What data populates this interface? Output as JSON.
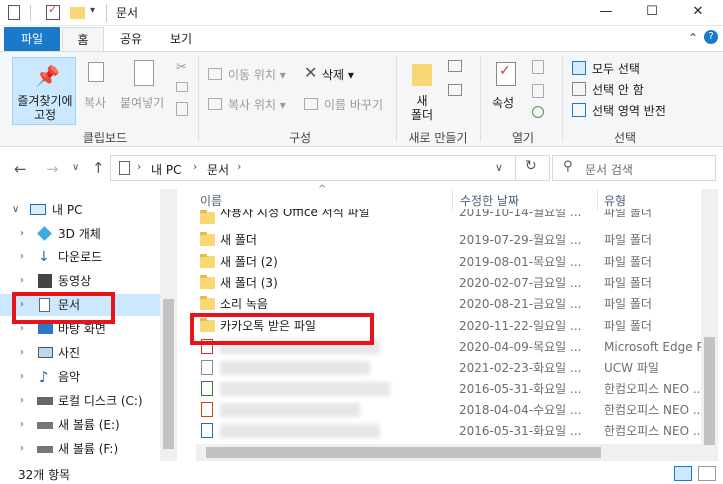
{
  "window": {
    "title": "문서",
    "controls": [
      "—",
      "☐",
      "✕"
    ]
  },
  "ribbon_tabs": [
    "파일",
    "홈",
    "공유",
    "보기"
  ],
  "ribbon": {
    "clipboard": {
      "pin_label": "즐겨찾기에\n고정",
      "copy": "복사",
      "paste": "붙여넣기",
      "group": "클립보드"
    },
    "organize": {
      "move_to": "이동 위치 ▾",
      "copy_to": "복사 위치 ▾",
      "delete": "삭제 ▾",
      "rename": "이름 바꾸기",
      "group": "구성"
    },
    "new": {
      "new_folder": "새\n폴더",
      "group": "새로 만들기"
    },
    "open": {
      "properties": "속성",
      "group": "열기"
    },
    "select": {
      "select_all": "모두 선택",
      "select_none": "선택 안 함",
      "invert": "선택 영역 반전",
      "group": "선택"
    }
  },
  "address": {
    "path": [
      "내 PC",
      "문서"
    ],
    "search_placeholder": "문서 검색"
  },
  "nav": [
    {
      "label": "내 PC",
      "icon": "pc-icon"
    },
    {
      "label": "3D 개체",
      "icon": "cube-icon"
    },
    {
      "label": "다운로드",
      "icon": "download-icon"
    },
    {
      "label": "동영상",
      "icon": "video-icon"
    },
    {
      "label": "문서",
      "icon": "document-icon"
    },
    {
      "label": "바탕 화면",
      "icon": "desktop-icon"
    },
    {
      "label": "사진",
      "icon": "picture-icon"
    },
    {
      "label": "음악",
      "icon": "music-icon"
    },
    {
      "label": "로컬 디스크 (C:)",
      "icon": "disk-icon"
    },
    {
      "label": "새 볼륨 (E:)",
      "icon": "disk-icon"
    },
    {
      "label": "새 볼륨 (F:)",
      "icon": "disk-icon"
    }
  ],
  "columns": {
    "name": "이름",
    "date": "수정한 날짜",
    "type": "유형"
  },
  "files": [
    {
      "name": "사용자 지정 Office 서식 파일",
      "date": "2019-10-14-월요일 ...",
      "type": "파일 폴더",
      "kind": "folder"
    },
    {
      "name": "새 폴더",
      "date": "2019-07-29-월요일 ...",
      "type": "파일 폴더",
      "kind": "folder"
    },
    {
      "name": "새 폴더 (2)",
      "date": "2019-08-01-목요일 ...",
      "type": "파일 폴더",
      "kind": "folder"
    },
    {
      "name": "새 폴더 (3)",
      "date": "2020-02-07-금요일 ...",
      "type": "파일 폴더",
      "kind": "folder"
    },
    {
      "name": "소리 녹음",
      "date": "2020-08-21-금요일 ...",
      "type": "파일 폴더",
      "kind": "folder"
    },
    {
      "name": "카카오톡 받은 파일",
      "date": "2020-11-22-일요일 ...",
      "type": "파일 폴더",
      "kind": "folder"
    },
    {
      "name": "",
      "date": "2020-04-09-목요일 ...",
      "type": "Microsoft Edge P...",
      "kind": "pdf"
    },
    {
      "name": "",
      "date": "2021-02-23-화요일 ...",
      "type": "UCW 파일",
      "kind": "file"
    },
    {
      "name": "",
      "date": "2016-05-31-화요일 ...",
      "type": "한컴오피스 NEO ...",
      "kind": "chart"
    },
    {
      "name": "",
      "date": "2018-04-04-수요일 ...",
      "type": "한컴오피스 NEO ...",
      "kind": "show"
    },
    {
      "name": "",
      "date": "2016-05-31-화요일 ...",
      "type": "한컴오피스 NEO ...",
      "kind": "doc"
    }
  ],
  "status": {
    "count": "32개 항목"
  },
  "colors": {
    "accent": "#1979ca",
    "highlight": "#e8141c",
    "selection": "#cce8ff"
  }
}
